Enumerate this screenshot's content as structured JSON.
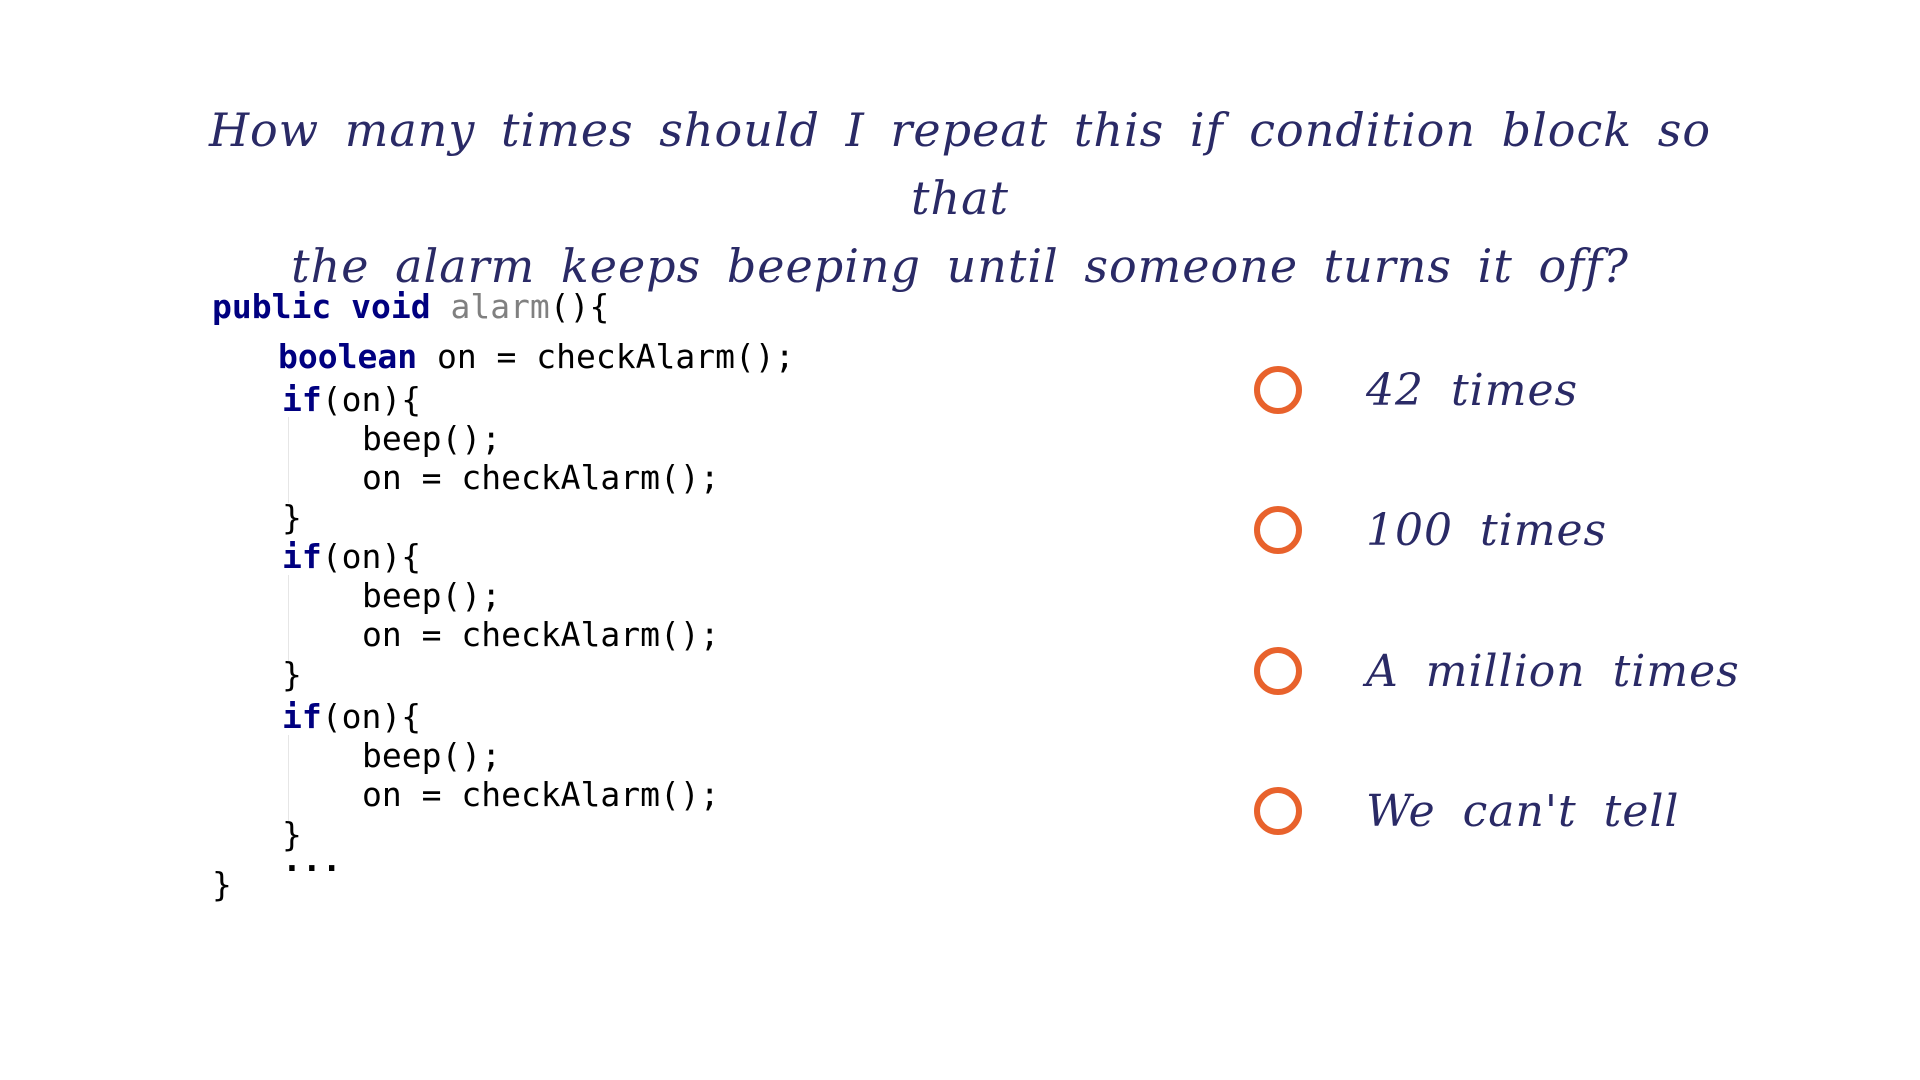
{
  "question": {
    "line1": "How many times should I repeat this if condition block so that",
    "line2": "the alarm keeps beeping until someone turns it off?"
  },
  "code": {
    "sig_public": "public",
    "sig_void": "void",
    "sig_name": "alarm",
    "sig_rest": "(){",
    "decl_type": "boolean",
    "decl_rest": " on = checkAlarm();",
    "if_kw": "if",
    "if_rest": "(on){",
    "beep": "beep();",
    "assign": "on = checkAlarm();",
    "close": "}",
    "ellipsis": "...",
    "end": "}"
  },
  "options": [
    {
      "label": "42 times"
    },
    {
      "label": "100 times"
    },
    {
      "label": "A million times"
    },
    {
      "label": "We can't tell"
    }
  ],
  "colors": {
    "question_text": "#2a2a66",
    "keyword": "#000080",
    "method_name": "#808080",
    "radio_ring": "#e8622c"
  }
}
